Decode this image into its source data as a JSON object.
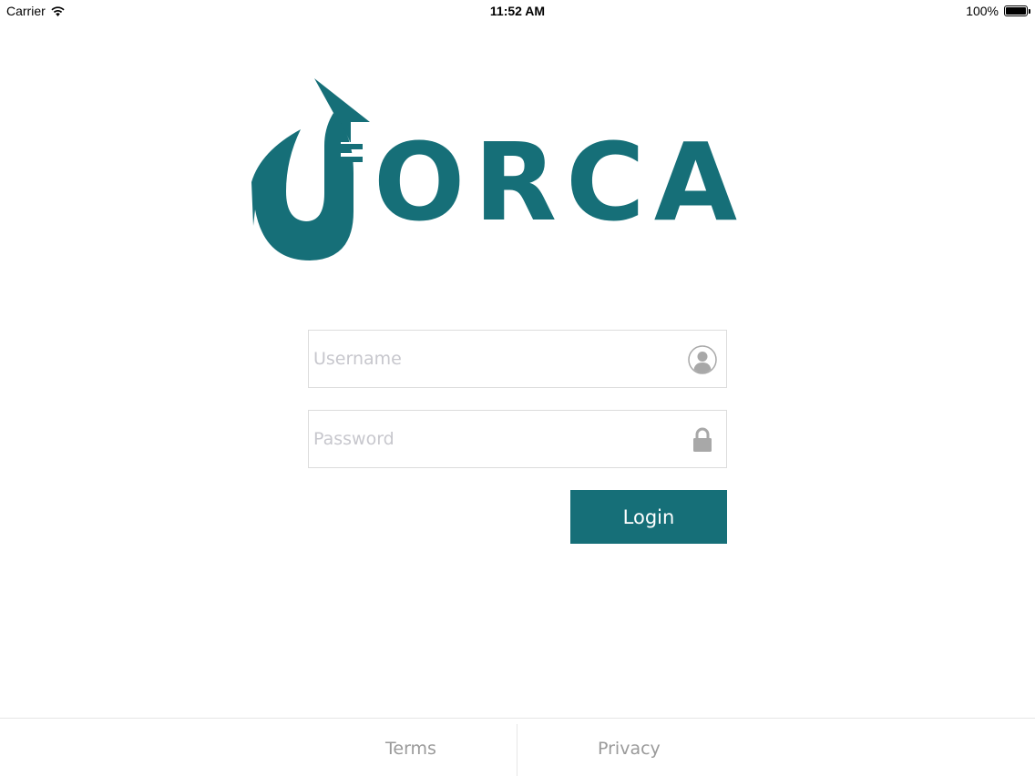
{
  "status_bar": {
    "carrier": "Carrier",
    "time": "11:52 AM",
    "battery_text": "100%",
    "battery_level": 1.0
  },
  "logo": {
    "text": "ORCA",
    "color": "#166f78"
  },
  "login_form": {
    "username_placeholder": "Username",
    "password_placeholder": "Password",
    "login_label": "Login",
    "accent_color": "#166f78"
  },
  "footer": {
    "terms_label": "Terms",
    "privacy_label": "Privacy"
  },
  "icons": {
    "wifi": "wifi-icon",
    "battery": "battery-icon",
    "user": "user-icon",
    "lock": "lock-icon"
  }
}
